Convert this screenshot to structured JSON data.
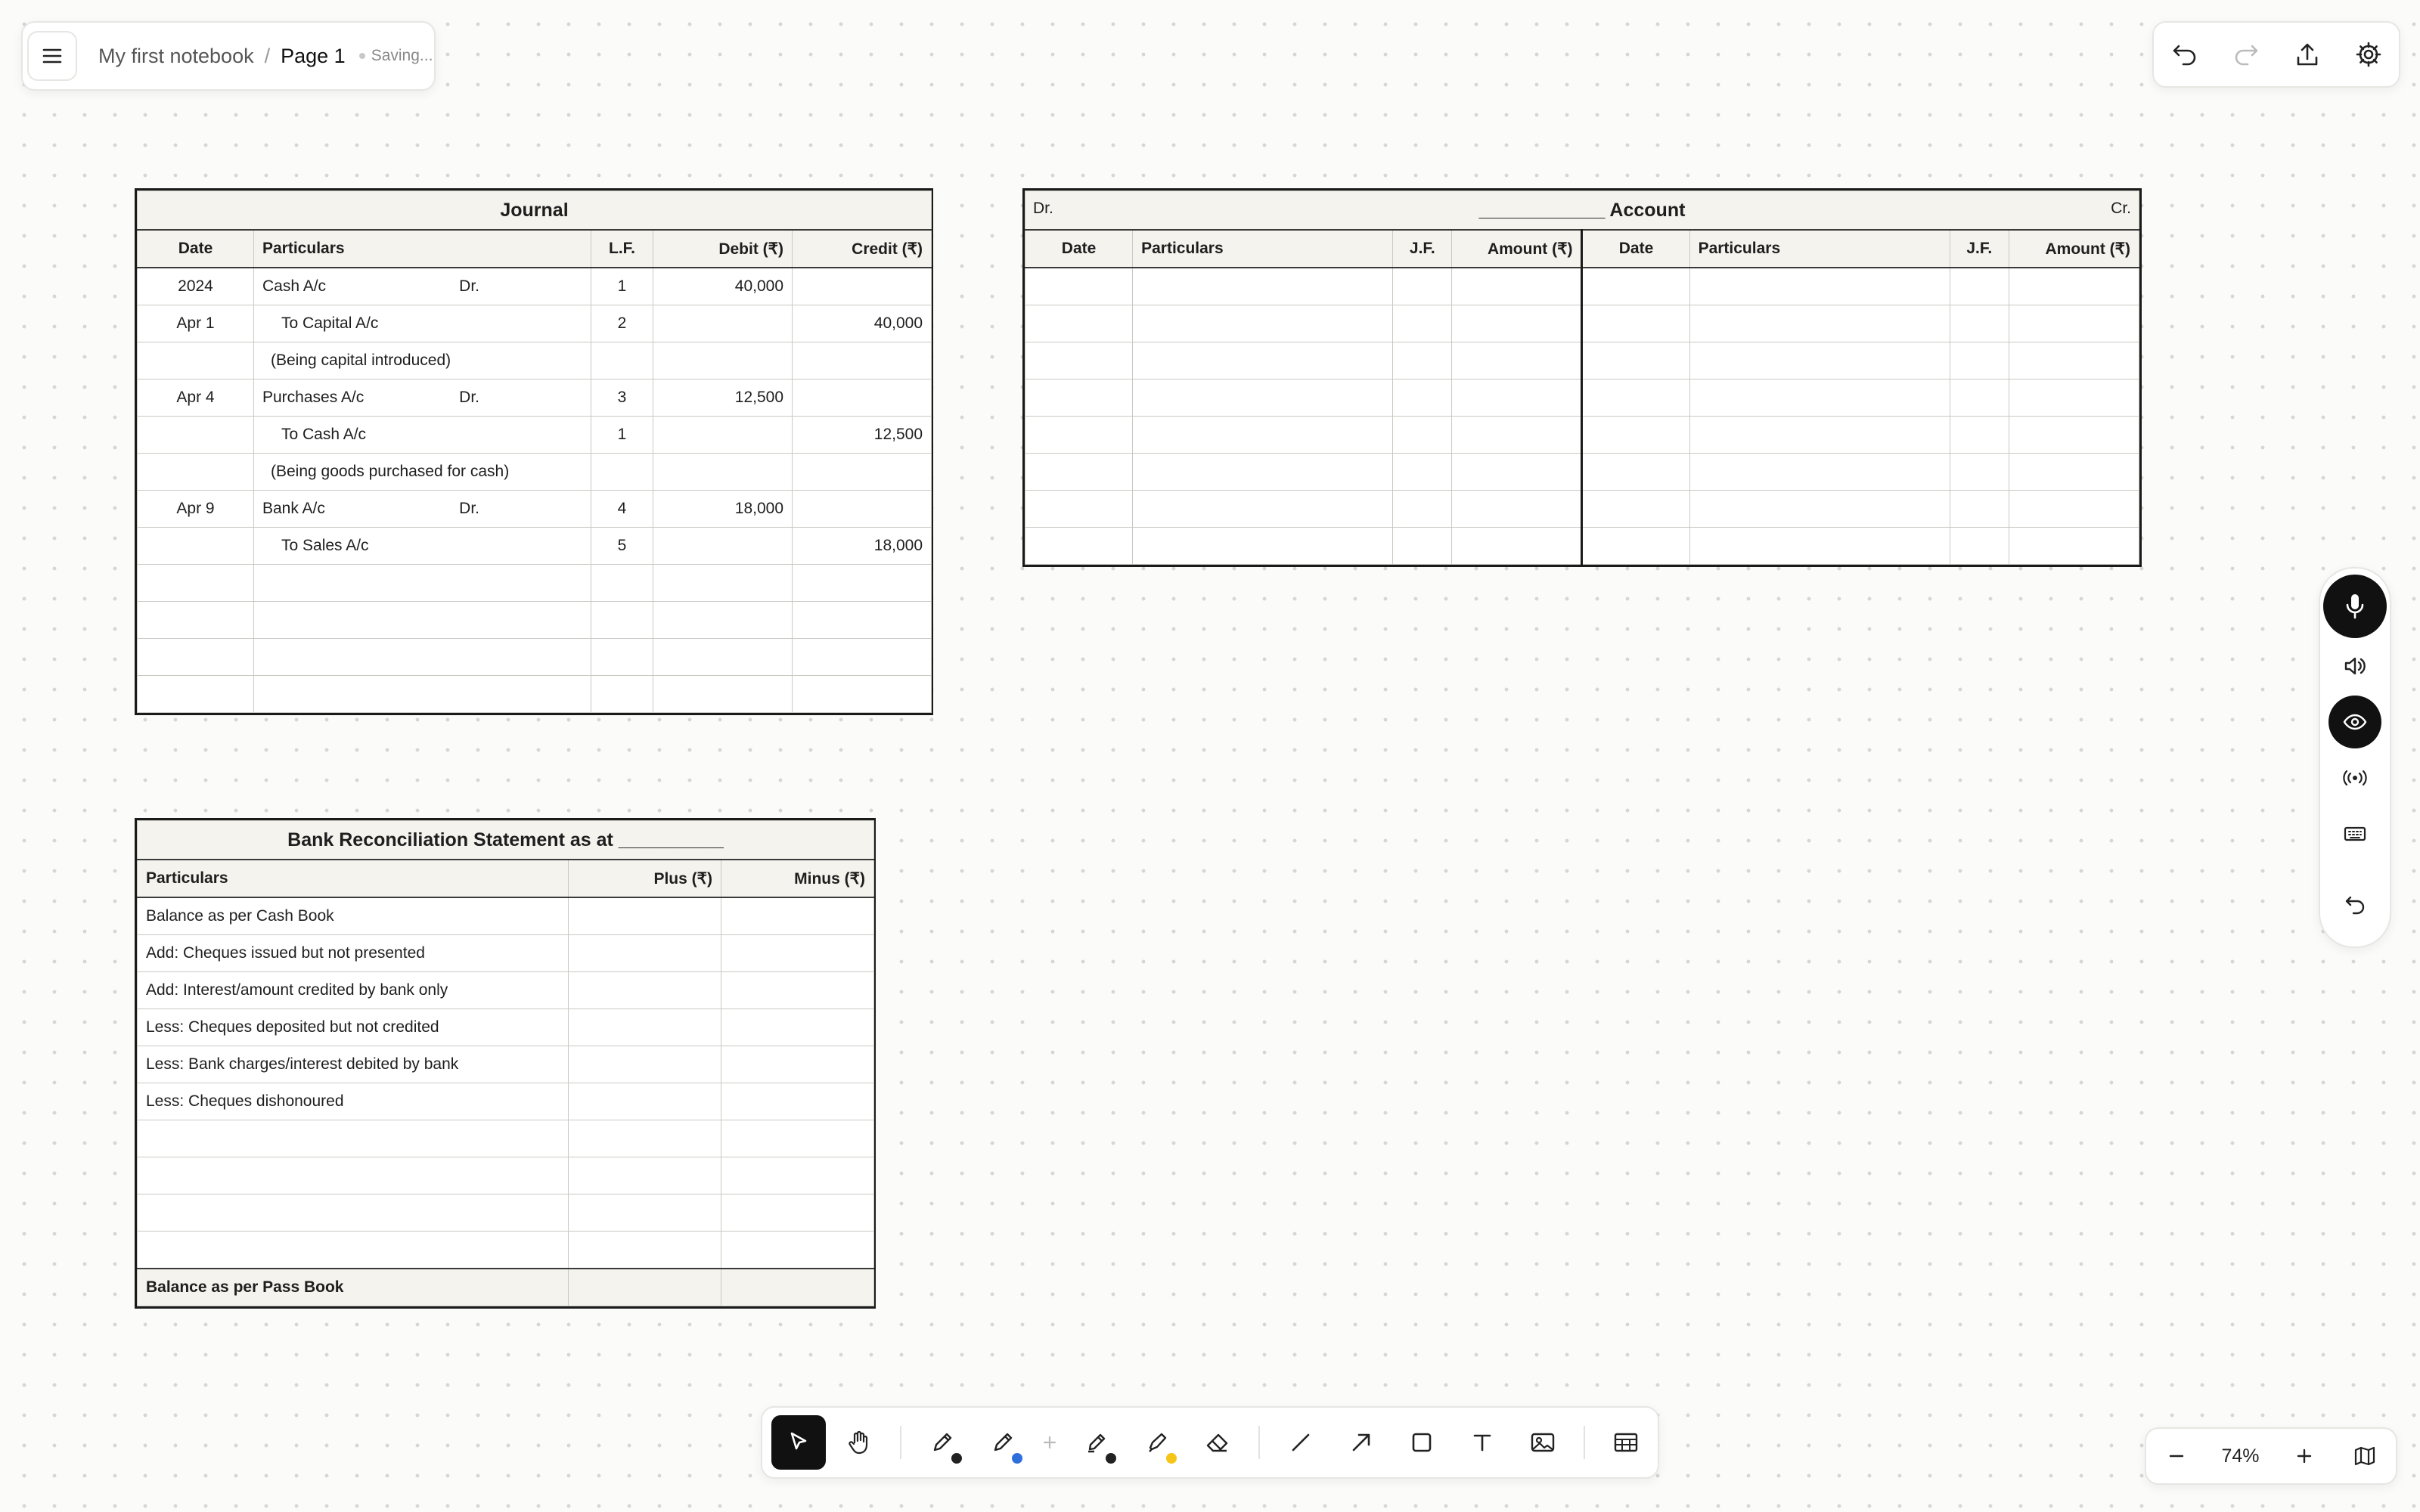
{
  "header": {
    "notebook": "My first notebook",
    "separator": "/",
    "page": "Page 1",
    "status": "Saving..."
  },
  "journal": {
    "title": "Journal",
    "columns": [
      "Date",
      "Particulars",
      "L.F.",
      "Debit (₹)",
      "Credit (₹)"
    ],
    "rows": [
      {
        "date": "2024",
        "particulars": "Cash A/c",
        "dr": "Dr.",
        "lf": "1",
        "debit": "40,000",
        "credit": "",
        "style": "debit"
      },
      {
        "date": "Apr 1",
        "particulars": "To Capital A/c",
        "dr": "",
        "lf": "2",
        "debit": "",
        "credit": "40,000",
        "style": "credit"
      },
      {
        "date": "",
        "particulars": "(Being capital introduced)",
        "dr": "",
        "lf": "",
        "debit": "",
        "credit": "",
        "style": "narration"
      },
      {
        "date": "Apr 4",
        "particulars": "Purchases A/c",
        "dr": "Dr.",
        "lf": "3",
        "debit": "12,500",
        "credit": "",
        "style": "debit"
      },
      {
        "date": "",
        "particulars": "To Cash A/c",
        "dr": "",
        "lf": "1",
        "debit": "",
        "credit": "12,500",
        "style": "credit"
      },
      {
        "date": "",
        "particulars": "(Being goods purchased for cash)",
        "dr": "",
        "lf": "",
        "debit": "",
        "credit": "",
        "style": "narration"
      },
      {
        "date": "Apr 9",
        "particulars": "Bank A/c",
        "dr": "Dr.",
        "lf": "4",
        "debit": "18,000",
        "credit": "",
        "style": "debit"
      },
      {
        "date": "",
        "particulars": "To Sales A/c",
        "dr": "",
        "lf": "5",
        "debit": "",
        "credit": "18,000",
        "style": "credit"
      },
      {
        "date": "",
        "particulars": "",
        "dr": "",
        "lf": "",
        "debit": "",
        "credit": "",
        "style": "blank"
      },
      {
        "date": "",
        "particulars": "",
        "dr": "",
        "lf": "",
        "debit": "",
        "credit": "",
        "style": "blank"
      },
      {
        "date": "",
        "particulars": "",
        "dr": "",
        "lf": "",
        "debit": "",
        "credit": "",
        "style": "blank"
      },
      {
        "date": "",
        "particulars": "",
        "dr": "",
        "lf": "",
        "debit": "",
        "credit": "",
        "style": "blank"
      }
    ]
  },
  "ledger": {
    "dr_label": "Dr.",
    "title": "____________ Account",
    "cr_label": "Cr.",
    "columns": [
      "Date",
      "Particulars",
      "J.F.",
      "Amount (₹)",
      "Date",
      "Particulars",
      "J.F.",
      "Amount (₹)"
    ],
    "blank_rows": 8
  },
  "brs": {
    "title": "Bank Reconciliation Statement as at __________",
    "columns": [
      "Particulars",
      "Plus (₹)",
      "Minus (₹)"
    ],
    "rows": [
      "Balance as per Cash Book",
      "Add: Cheques issued but not presented",
      "Add: Interest/amount credited by bank only",
      "Less: Cheques deposited but not credited",
      "Less: Bank charges/interest debited by bank",
      "Less: Cheques dishonoured",
      "",
      "",
      "",
      ""
    ],
    "footer": "Balance as per Pass Book"
  },
  "toolbar": {
    "tools": [
      "select",
      "hand",
      "pencil",
      "pen",
      "add",
      "marker",
      "highlighter",
      "eraser",
      "line",
      "arrow",
      "rectangle",
      "text",
      "image",
      "table"
    ],
    "swatches": {
      "pencil": "#222222",
      "pen": "#2f6fdb",
      "marker": "#222222",
      "highlighter": "#f5c518"
    }
  },
  "zoom": {
    "value": "74%",
    "minus": "−",
    "plus": "+"
  },
  "icons": [
    "menu-icon",
    "undo-icon",
    "redo-icon",
    "share-icon",
    "settings-icon",
    "microphone-icon",
    "speaker-icon",
    "eye-icon",
    "broadcast-icon",
    "keyboard-icon",
    "reset-icon",
    "map-icon"
  ]
}
